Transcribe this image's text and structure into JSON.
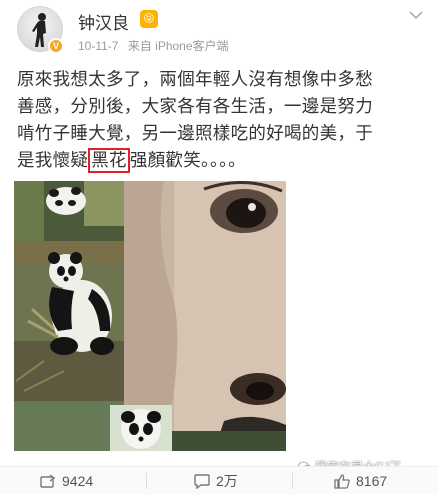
{
  "post": {
    "author": "钟汉良",
    "time": "10-11-7",
    "source": "来自 iPhone客户端",
    "text_line1": "原來我想太多了，兩個年輕人沒有想像中多愁",
    "text_line2": "善感，分別後，大家各有各生活，一邊是努力",
    "text_line3": "啃竹子睡大覺，另一邊照樣吃的好喝的美，于",
    "text_line4_pre": "是我懷疑",
    "text_line4_highlight": "黑花",
    "text_line4_post": "强顏歡笑。。。。",
    "highlight_color": "#e0202a"
  },
  "actions": {
    "repost_count": "9424",
    "comment_count": "2万",
    "like_count": "8167"
  },
  "watermark": {
    "text": "我究在是大CJ了"
  },
  "icons": {
    "avatar": "person-silhouette",
    "badge": "verified-v-icon",
    "emoji": "emoji-badge-icon",
    "menu": "chevron-down-icon",
    "repost": "repost-icon",
    "comment": "comment-icon",
    "like": "thumbs-up-icon",
    "watermark": "wechat-icon"
  }
}
